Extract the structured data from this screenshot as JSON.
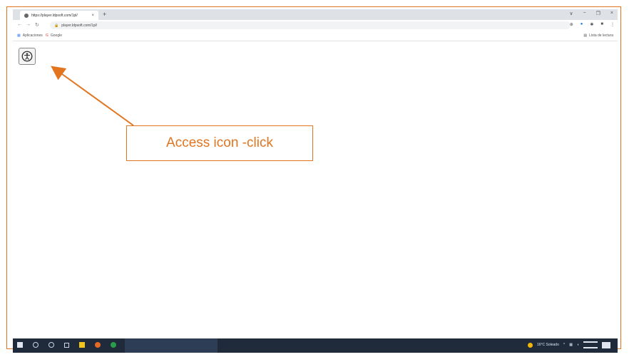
{
  "browser": {
    "tab_title": "https://player.ldpsoft.com/1pl/",
    "new_tab_glyph": "+",
    "tab_close_glyph": "×",
    "window_controls": [
      "∨",
      "−",
      "❐",
      "×"
    ],
    "url": "player.ldpsoft.com/1pl/",
    "bookmarks": [
      {
        "label": "Aplicaciones",
        "icon": "apps-icon"
      },
      {
        "label": "Google",
        "icon": "google-icon"
      }
    ],
    "reading_list_label": "Lista de lectura"
  },
  "page": {
    "access_icon": "accessibility-icon"
  },
  "annotation": {
    "callout_text": "Access icon -click",
    "color": "#e2751f"
  },
  "taskbar": {
    "weather_text": "16°C Soleado"
  }
}
